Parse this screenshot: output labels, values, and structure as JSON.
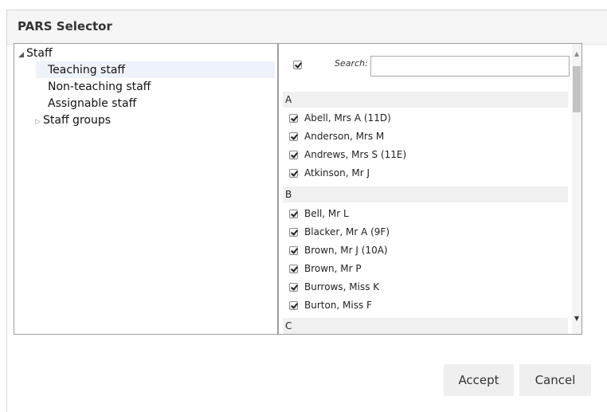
{
  "dialog": {
    "title": "PARS Selector",
    "accept_label": "Accept",
    "cancel_label": "Cancel"
  },
  "tree": {
    "root": {
      "label": "Staff",
      "expanded": true,
      "toggle_glyph": "◢"
    },
    "children": [
      {
        "label": "Teaching staff",
        "selected": true
      },
      {
        "label": "Non-teaching staff",
        "selected": false
      },
      {
        "label": "Assignable staff",
        "selected": false
      },
      {
        "label": "Staff groups",
        "expandable": true,
        "toggle_glyph": "▷"
      }
    ]
  },
  "list": {
    "select_all_checked": true,
    "search_label": "Search:",
    "search_value": "",
    "groups": [
      {
        "letter": "A",
        "items": [
          {
            "name": "Abell, Mrs A (11D)",
            "checked": true
          },
          {
            "name": "Anderson, Mrs M",
            "checked": true
          },
          {
            "name": "Andrews, Mrs S (11E)",
            "checked": true
          },
          {
            "name": "Atkinson, Mr J",
            "checked": true
          }
        ]
      },
      {
        "letter": "B",
        "items": [
          {
            "name": "Bell, Mr L",
            "checked": true
          },
          {
            "name": "Blacker, Mr A (9F)",
            "checked": true
          },
          {
            "name": "Brown, Mr J (10A)",
            "checked": true
          },
          {
            "name": "Brown, Mr P",
            "checked": true
          },
          {
            "name": "Burrows, Miss K",
            "checked": true
          },
          {
            "name": "Burton, Miss F",
            "checked": true
          }
        ]
      },
      {
        "letter": "C",
        "items": []
      }
    ]
  },
  "icons": {
    "scroll_up": "▲",
    "scroll_down": "▼"
  },
  "colors": {
    "selected_row": "#eef3fa",
    "group_header": "#f0f0f0",
    "button_bg": "#efefef"
  }
}
